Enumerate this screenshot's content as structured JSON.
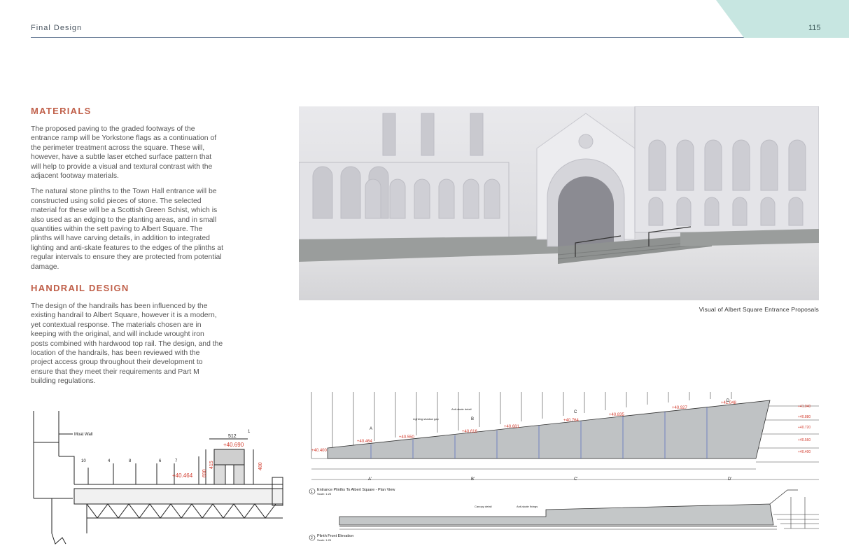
{
  "header": {
    "title": "Final Design",
    "page_number": "115"
  },
  "colors": {
    "accent_heading": "#c0604a",
    "tab": "#c7e6e1",
    "rule": "#6b7f99"
  },
  "materials": {
    "heading": "MATERIALS",
    "paragraphs": [
      "The proposed paving to the graded footways of the entrance ramp will be Yorkstone flags as a continuation of the perimeter treatment across the square. These will, however, have a  subtle laser etched surface pattern that will help to provide a visual and textural contrast with the adjacent footway materials.",
      "The natural stone plinths to the Town Hall entrance will be constructed using solid pieces of stone. The selected material for these will be a Scottish Green Schist, which is also used as an edging to the planting areas, and in small quantities within the sett paving to Albert Square. The plinths will have carving details, in addition to integrated lighting and anti-skate features to the edges of the plinths at regular intervals to ensure they are protected from potential damage."
    ]
  },
  "handrail": {
    "heading": "HANDRAIL DESIGN",
    "paragraph": "The design of the handrails has been influenced by the existing handrail to Albert Square, however it is a modern, yet contextual response. The materials chosen are in keeping with the original, and will include wrought iron posts combined with hardwood top rail. The design, and the location of the handrails, has been reviewed with the project access group throughout their development to ensure that they meet their requirements and Part M building regulations."
  },
  "visual": {
    "caption": "Visual of Albert Square Entrance Proposals"
  },
  "detail": {
    "moat_wall_label": "Moat Wall",
    "dim_width": "512",
    "level_top": "+40.690",
    "level_pave": "+40.464",
    "dim_height": "480",
    "dim_415": "415",
    "dim_690": "690",
    "callouts": [
      "1",
      "10",
      "4",
      "8",
      "6",
      "7"
    ]
  },
  "elevation": {
    "plan_title": "Entrance Plinths To Albert Square - Plan View",
    "plan_scale": "Scale: 1:25",
    "front_title": "Plinth Front Elevation",
    "front_scale": "Scale: 1:25",
    "plan_number": "1",
    "front_number": "2",
    "levels_top": [
      "+40.400",
      "+40.464",
      "+40.550",
      "+40.616",
      "+40.681",
      "+40.764",
      "+40.835",
      "+40.927",
      "+41.048"
    ],
    "levels_right": [
      "+41.040",
      "+40.880",
      "+40.720",
      "+40.560",
      "+40.400"
    ],
    "section_marks": [
      "A",
      "B",
      "C",
      "D",
      "A'",
      "B'",
      "C'",
      "D'"
    ],
    "notes": [
      "Lighting shadow gap",
      "Anti-skate detail",
      "Canopy detail",
      "Anti-skate fixings"
    ]
  }
}
